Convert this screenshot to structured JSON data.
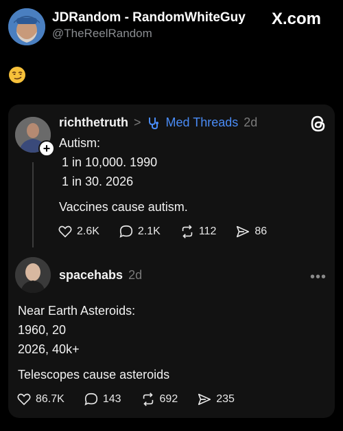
{
  "tweet": {
    "display_name": "JDRandom - RandomWhiteGuy",
    "handle": "@TheReelRandom",
    "source": "X.com",
    "emoji": "smirking-face"
  },
  "embed": {
    "post1": {
      "username": "richthetruth",
      "chevron": ">",
      "topic": "Med Threads",
      "time": "2d",
      "lines": [
        "Autism:",
        "1 in 10,000.  1990",
        "1 in 30.  2026",
        "Vaccines cause autism."
      ],
      "actions": {
        "likes": "2.6K",
        "replies": "2.1K",
        "reposts": "112",
        "shares": "86"
      }
    },
    "post2": {
      "username": "spacehabs",
      "time": "2d",
      "lines": [
        "Near Earth Asteroids:",
        "1960,  20",
        "2026,  40k+",
        "Telescopes cause asteroids"
      ],
      "actions": {
        "likes": "86.7K",
        "replies": "143",
        "reposts": "692",
        "shares": "235"
      }
    },
    "more_label": "•••",
    "plus_label": "+"
  },
  "colors": {
    "background": "#000000",
    "card": "#121212",
    "topic": "#4a8cf7",
    "muted": "#8a8d91"
  }
}
